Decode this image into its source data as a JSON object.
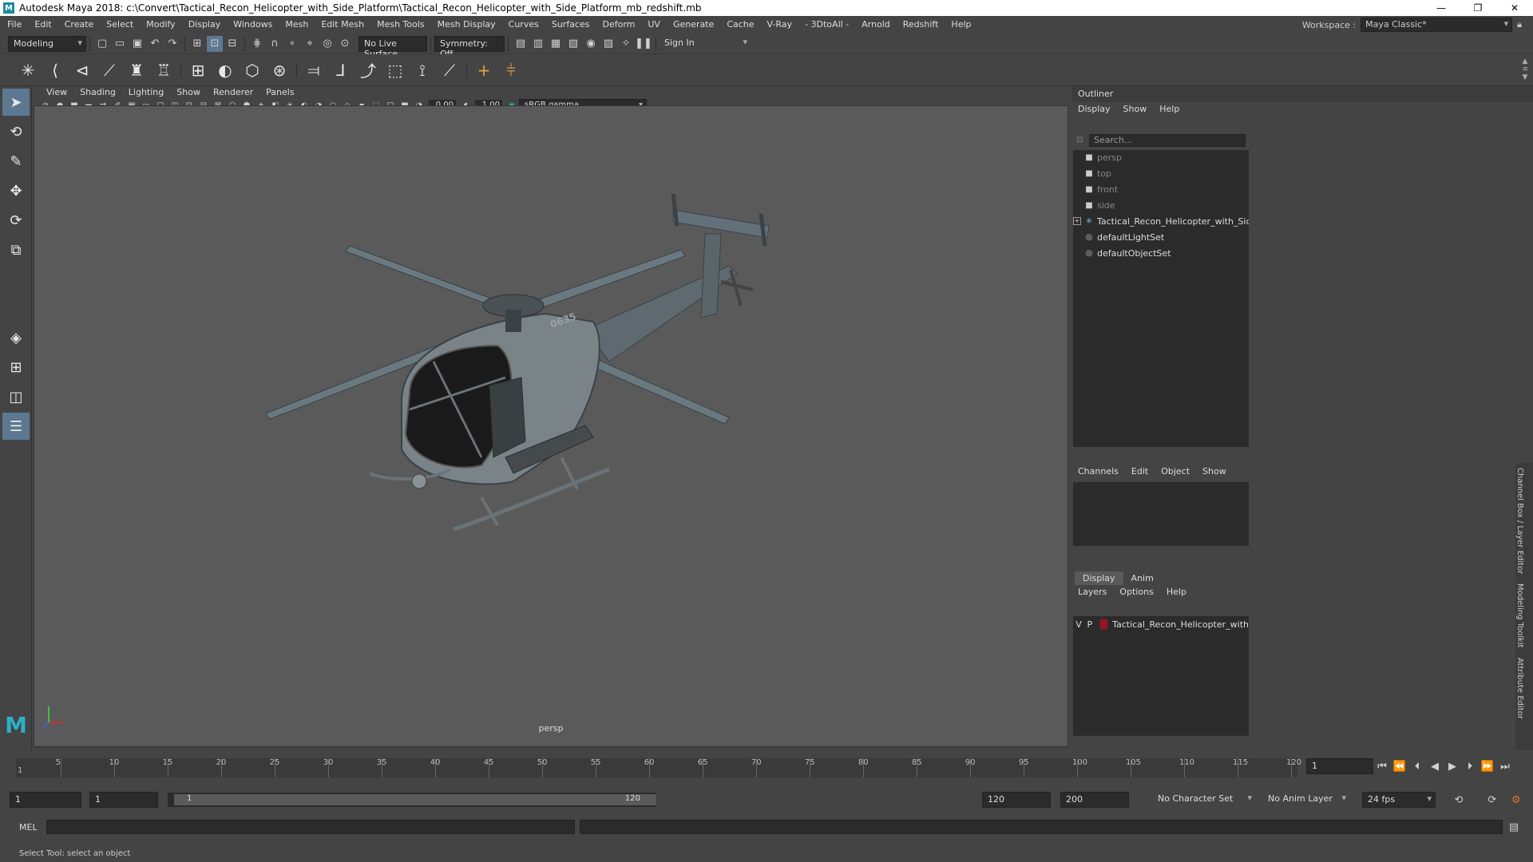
{
  "window": {
    "title": "Autodesk Maya 2018: c:\\Convert\\Tactical_Recon_Helicopter_with_Side_Platform\\Tactical_Recon_Helicopter_with_Side_Platform_mb_redshift.mb",
    "logo_letter": "M"
  },
  "menubar": {
    "items": [
      "File",
      "Edit",
      "Create",
      "Select",
      "Modify",
      "Display",
      "Windows",
      "Mesh",
      "Edit Mesh",
      "Mesh Tools",
      "Mesh Display",
      "Curves",
      "Surfaces",
      "Deform",
      "UV",
      "Generate",
      "Cache",
      "V-Ray",
      "- 3DtoAll -",
      "Arnold",
      "Redshift",
      "Help"
    ],
    "workspace_label": "Workspace :",
    "workspace_value": "Maya Classic*"
  },
  "statusline": {
    "mode": "Modeling",
    "live_surface": "No Live Surface",
    "symmetry": "Symmetry: Off",
    "sign_in": "Sign In"
  },
  "viewport": {
    "menus": [
      "View",
      "Shading",
      "Lighting",
      "Show",
      "Renderer",
      "Panels"
    ],
    "exposure": "0.00",
    "gamma": "1.00",
    "colorspace": "sRGB gamma",
    "camera_label": "persp"
  },
  "outliner": {
    "title": "Outliner",
    "menus": [
      "Display",
      "Show",
      "Help"
    ],
    "search_placeholder": "Search...",
    "items": [
      {
        "label": "persp",
        "icon": "camera-icon",
        "dim": true
      },
      {
        "label": "top",
        "icon": "camera-icon",
        "dim": true
      },
      {
        "label": "front",
        "icon": "camera-icon",
        "dim": true
      },
      {
        "label": "side",
        "icon": "camera-icon",
        "dim": true
      },
      {
        "label": "Tactical_Recon_Helicopter_with_Side_Pla",
        "icon": "transform-icon",
        "dim": false
      },
      {
        "label": "defaultLightSet",
        "icon": "set-icon",
        "dim": false
      },
      {
        "label": "defaultObjectSet",
        "icon": "set-icon",
        "dim": false
      }
    ]
  },
  "channelbox": {
    "menus": [
      "Channels",
      "Edit",
      "Object",
      "Show"
    ]
  },
  "layereditor": {
    "tabs": [
      "Display",
      "Anim"
    ],
    "menus": [
      "Layers",
      "Options",
      "Help"
    ],
    "layer": {
      "v": "V",
      "p": "P",
      "name": "Tactical_Recon_Helicopter_with",
      "color": "#a0102a"
    }
  },
  "sidetabs": [
    "Channel Box / Layer Editor",
    "Modeling Toolkit",
    "Attribute Editor"
  ],
  "timeslider": {
    "ticks": [
      5,
      10,
      15,
      20,
      25,
      30,
      35,
      40,
      45,
      50,
      55,
      60,
      65,
      70,
      75,
      80,
      85,
      90,
      95,
      100,
      105,
      110,
      115,
      120
    ],
    "start_label": "1",
    "current_frame": "1"
  },
  "rangeslider": {
    "start": "1",
    "playback_start": "1",
    "range_start": "1",
    "range_end": "120",
    "playback_end": "120",
    "end": "200",
    "character_set": "No Character Set",
    "anim_layer": "No Anim Layer",
    "fps": "24 fps"
  },
  "cmdline": {
    "label": "MEL"
  },
  "helpline": {
    "text": "Select Tool: select an object"
  }
}
